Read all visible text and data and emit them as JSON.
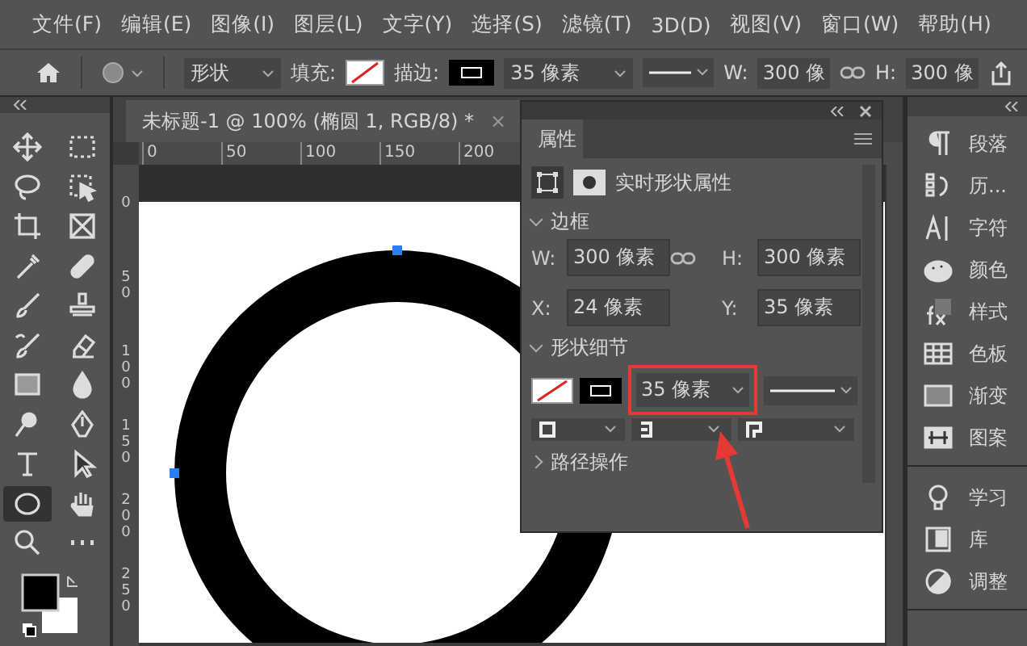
{
  "menu_bar": {
    "items": [
      "文件(F)",
      "编辑(E)",
      "图像(I)",
      "图层(L)",
      "文字(Y)",
      "选择(S)",
      "滤镜(T)",
      "3D(D)",
      "视图(V)",
      "窗口(W)",
      "帮助(H)"
    ]
  },
  "options_bar": {
    "mode": "形状",
    "fill_label": "填充:",
    "stroke_label": "描边:",
    "stroke_width": "35 像素",
    "width_label": "W:",
    "width_value": "300 像",
    "height_label": "H:",
    "height_value": "300 像"
  },
  "document_tab": {
    "title": "未标题-1 @ 100% (椭圆 1, RGB/8) *",
    "close": "×"
  },
  "rulers": {
    "horizontal": [
      "0",
      "50",
      "100",
      "150",
      "200"
    ],
    "vertical": [
      "0",
      "50",
      "100",
      "150",
      "200",
      "250"
    ]
  },
  "toolbar": {
    "tools": [
      {
        "kind": "move",
        "selected": false
      },
      {
        "kind": "marquee",
        "selected": false
      },
      {
        "kind": "lasso",
        "selected": false
      },
      {
        "kind": "object-select",
        "selected": false
      },
      {
        "kind": "crop",
        "selected": false
      },
      {
        "kind": "frame",
        "selected": false
      },
      {
        "kind": "eyedropper",
        "selected": false
      },
      {
        "kind": "healing",
        "selected": false
      },
      {
        "kind": "brush",
        "selected": false
      },
      {
        "kind": "stamp",
        "selected": false
      },
      {
        "kind": "history-brush",
        "selected": false
      },
      {
        "kind": "eraser",
        "selected": false
      },
      {
        "kind": "gradient",
        "selected": false
      },
      {
        "kind": "blur",
        "selected": false
      },
      {
        "kind": "dodge",
        "selected": false
      },
      {
        "kind": "pen",
        "selected": false
      },
      {
        "kind": "type",
        "selected": false
      },
      {
        "kind": "path-select",
        "selected": false
      },
      {
        "kind": "ellipse",
        "selected": true
      },
      {
        "kind": "hand",
        "selected": false
      },
      {
        "kind": "zoom",
        "selected": false
      },
      {
        "kind": "more",
        "selected": false
      }
    ]
  },
  "properties_panel": {
    "tab": "属性",
    "header": "实时形状属性",
    "sections": [
      {
        "kind": "bounds",
        "title": "边框",
        "expanded": true,
        "fields": [
          {
            "label": "W:",
            "value": "300 像素"
          },
          {
            "label": "H:",
            "value": "300 像素"
          },
          {
            "label": "X:",
            "value": "24 像素"
          },
          {
            "label": "Y:",
            "value": "35 像素"
          }
        ]
      },
      {
        "kind": "shape-details",
        "title": "形状细节",
        "expanded": true,
        "stroke_width": "35 像素"
      },
      {
        "kind": "path-operations",
        "title": "路径操作",
        "expanded": false
      }
    ]
  },
  "right_dock": {
    "items": [
      {
        "kind": "paragraph",
        "label": "段落"
      },
      {
        "kind": "history",
        "label": "历..."
      },
      {
        "kind": "character",
        "label": "字符"
      },
      {
        "kind": "color",
        "label": "颜色"
      },
      {
        "kind": "styles",
        "label": "样式"
      },
      {
        "kind": "swatches",
        "label": "色板"
      },
      {
        "kind": "gradients",
        "label": "渐变"
      },
      {
        "kind": "patterns",
        "label": "图案"
      },
      {
        "kind": "learn",
        "label": "学习"
      },
      {
        "kind": "libraries",
        "label": "库"
      },
      {
        "kind": "adjustments",
        "label": "调整"
      }
    ]
  }
}
